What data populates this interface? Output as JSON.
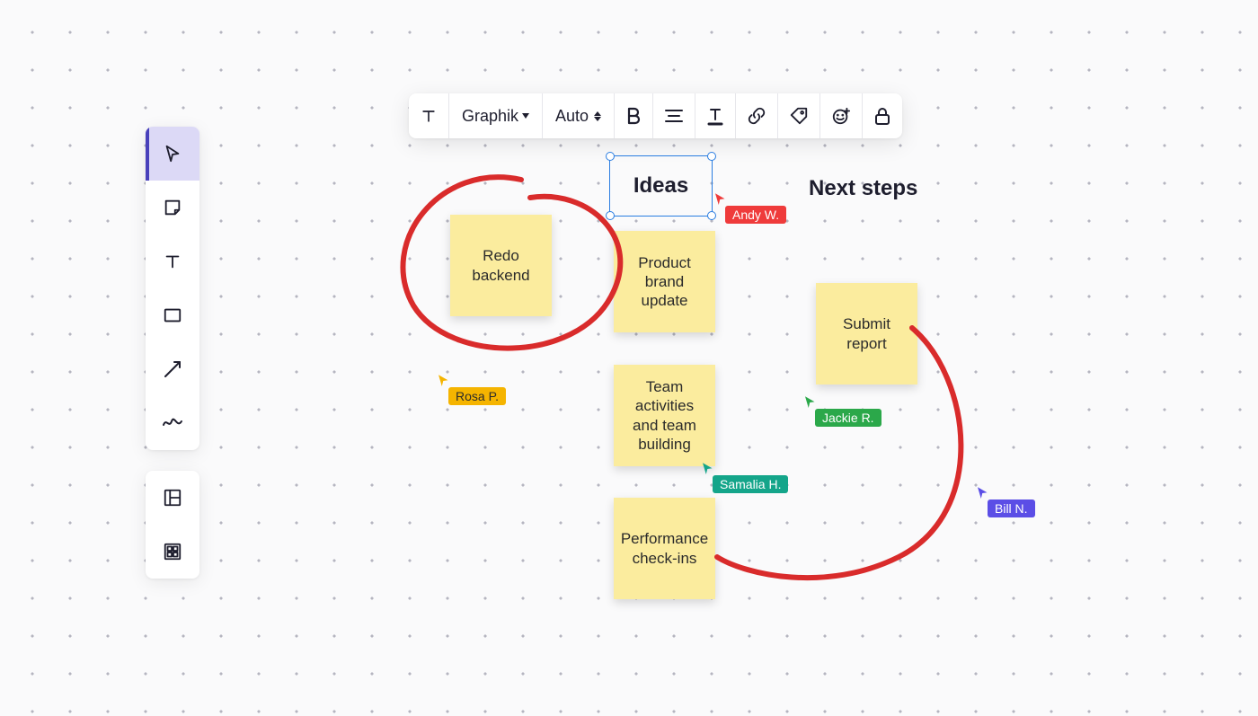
{
  "tools": {
    "select": "Select",
    "sticky": "Sticky note",
    "text": "Text",
    "shape": "Shape",
    "line": "Line/Arrow",
    "draw": "Draw"
  },
  "tools2": {
    "template": "Template",
    "apps": "Apps"
  },
  "formatBar": {
    "font": "Graphik",
    "size": "Auto"
  },
  "headings": {
    "ideas": "Ideas",
    "nextSteps": "Next steps"
  },
  "stickies": {
    "redo": "Redo backend",
    "brand": "Product brand update",
    "team": "Team activities and team building",
    "perf": "Performance check-ins",
    "submit": "Submit report"
  },
  "collaborators": {
    "andy": {
      "name": "Andy W.",
      "color": "#ef3b3b"
    },
    "rosa": {
      "name": "Rosa P.",
      "color": "#f5b400"
    },
    "samalia": {
      "name": "Samalia H.",
      "color": "#14a58a"
    },
    "jackie": {
      "name": "Jackie R.",
      "color": "#2ba84a"
    },
    "bill": {
      "name": "Bill N.",
      "color": "#5b4ee6"
    }
  },
  "colors": {
    "stickyBg": "#fbec9e",
    "selection": "#2a7de1",
    "stroke": "#d92b2b"
  }
}
